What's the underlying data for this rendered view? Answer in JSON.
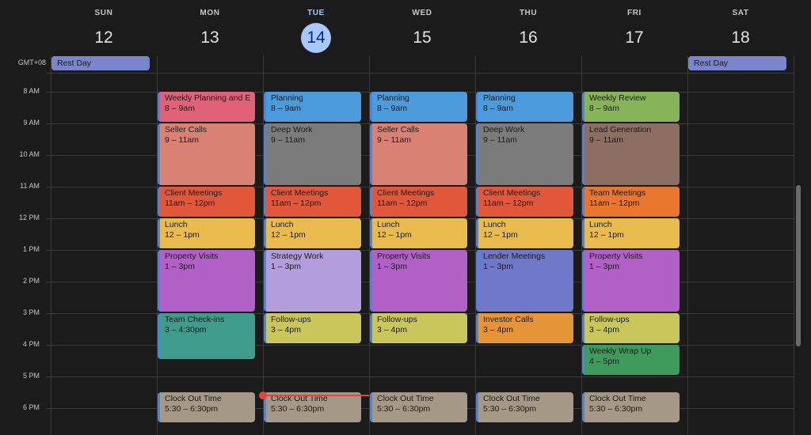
{
  "timezone": "GMT+08",
  "days": [
    {
      "dow": "SUN",
      "date": "12",
      "today": false
    },
    {
      "dow": "MON",
      "date": "13",
      "today": false
    },
    {
      "dow": "TUE",
      "date": "14",
      "today": true
    },
    {
      "dow": "WED",
      "date": "15",
      "today": false
    },
    {
      "dow": "THU",
      "date": "16",
      "today": false
    },
    {
      "dow": "FRI",
      "date": "17",
      "today": false
    },
    {
      "dow": "SAT",
      "date": "18",
      "today": false
    }
  ],
  "hours": [
    "8 AM",
    "9 AM",
    "10 AM",
    "11 AM",
    "12 PM",
    "1 PM",
    "2 PM",
    "3 PM",
    "4 PM",
    "5 PM",
    "6 PM"
  ],
  "all_day": [
    {
      "day": 0,
      "title": "Rest Day",
      "color": "#7986cb"
    },
    {
      "day": 6,
      "title": "Rest Day",
      "color": "#7986cb"
    }
  ],
  "colors": {
    "accent_today": "#a8c7fa",
    "now_indicator": "#ea4335"
  },
  "events": [
    {
      "day": 1,
      "start": 8,
      "end": 9,
      "title": "Weekly Planning and Email",
      "time": "8 – 9am",
      "color": "#e06178"
    },
    {
      "day": 1,
      "start": 9,
      "end": 11,
      "title": "Seller Calls",
      "time": "9 – 11am",
      "color": "#d98274"
    },
    {
      "day": 1,
      "start": 11,
      "end": 12,
      "title": "Client Meetings",
      "time": "11am – 12pm",
      "color": "#e0573a"
    },
    {
      "day": 1,
      "start": 12,
      "end": 13,
      "title": "Lunch",
      "time": "12 – 1pm",
      "color": "#e9bb4c"
    },
    {
      "day": 1,
      "start": 13,
      "end": 15,
      "title": "Property Visits",
      "time": "1 – 3pm",
      "color": "#b160c6"
    },
    {
      "day": 1,
      "start": 15,
      "end": 16.5,
      "title": "Team Check-ins",
      "time": "3 – 4:30pm",
      "color": "#3f9b8c"
    },
    {
      "day": 1,
      "start": 17.5,
      "end": 18.5,
      "title": "Clock Out Time",
      "time": "5:30 – 6:30pm",
      "color": "#a69887"
    },
    {
      "day": 2,
      "start": 8,
      "end": 9,
      "title": "Planning",
      "time": "8 – 9am",
      "color": "#4c9bdc"
    },
    {
      "day": 2,
      "start": 9,
      "end": 11,
      "title": "Deep Work",
      "time": "9 – 11am",
      "color": "#7b7b7b"
    },
    {
      "day": 2,
      "start": 11,
      "end": 12,
      "title": "Client Meetings",
      "time": "11am – 12pm",
      "color": "#e0573a"
    },
    {
      "day": 2,
      "start": 12,
      "end": 13,
      "title": "Lunch",
      "time": "12 – 1pm",
      "color": "#e9bb4c"
    },
    {
      "day": 2,
      "start": 13,
      "end": 15,
      "title": "Strategy Work",
      "time": "1 – 3pm",
      "color": "#b39ddb"
    },
    {
      "day": 2,
      "start": 15,
      "end": 16,
      "title": "Follow-ups",
      "time": "3 – 4pm",
      "color": "#c9c65b"
    },
    {
      "day": 2,
      "start": 17.5,
      "end": 18.5,
      "title": "Clock Out Time",
      "time": "5:30 – 6:30pm",
      "color": "#a69887"
    },
    {
      "day": 3,
      "start": 8,
      "end": 9,
      "title": "Planning",
      "time": "8 – 9am",
      "color": "#4c9bdc"
    },
    {
      "day": 3,
      "start": 9,
      "end": 11,
      "title": "Seller Calls",
      "time": "9 – 11am",
      "color": "#d98274"
    },
    {
      "day": 3,
      "start": 11,
      "end": 12,
      "title": "Client Meetings",
      "time": "11am – 12pm",
      "color": "#e0573a"
    },
    {
      "day": 3,
      "start": 12,
      "end": 13,
      "title": "Lunch",
      "time": "12 – 1pm",
      "color": "#e9bb4c"
    },
    {
      "day": 3,
      "start": 13,
      "end": 15,
      "title": "Property Visits",
      "time": "1 – 3pm",
      "color": "#b160c6"
    },
    {
      "day": 3,
      "start": 15,
      "end": 16,
      "title": "Follow-ups",
      "time": "3 – 4pm",
      "color": "#c9c65b"
    },
    {
      "day": 3,
      "start": 17.5,
      "end": 18.5,
      "title": "Clock Out Time",
      "time": "5:30 – 6:30pm",
      "color": "#a69887"
    },
    {
      "day": 4,
      "start": 8,
      "end": 9,
      "title": "Planning",
      "time": "8 – 9am",
      "color": "#4c9bdc"
    },
    {
      "day": 4,
      "start": 9,
      "end": 11,
      "title": "Deep Work",
      "time": "9 – 11am",
      "color": "#7b7b7b"
    },
    {
      "day": 4,
      "start": 11,
      "end": 12,
      "title": "Client Meetings",
      "time": "11am – 12pm",
      "color": "#e0573a"
    },
    {
      "day": 4,
      "start": 12,
      "end": 13,
      "title": "Lunch",
      "time": "12 – 1pm",
      "color": "#e9bb4c"
    },
    {
      "day": 4,
      "start": 13,
      "end": 15,
      "title": "Lender Meetings",
      "time": "1 – 3pm",
      "color": "#6f78c9"
    },
    {
      "day": 4,
      "start": 15,
      "end": 16,
      "title": "Investor Calls",
      "time": "3 – 4pm",
      "color": "#e59536"
    },
    {
      "day": 4,
      "start": 17.5,
      "end": 18.5,
      "title": "Clock Out Time",
      "time": "5:30 – 6:30pm",
      "color": "#a69887"
    },
    {
      "day": 5,
      "start": 8,
      "end": 9,
      "title": "Weekly Review",
      "time": "8 – 9am",
      "color": "#86b456"
    },
    {
      "day": 5,
      "start": 9,
      "end": 11,
      "title": "Lead Generation",
      "time": "9 – 11am",
      "color": "#8d6e63"
    },
    {
      "day": 5,
      "start": 11,
      "end": 12,
      "title": "Team Meetings",
      "time": "11am – 12pm",
      "color": "#e8762d"
    },
    {
      "day": 5,
      "start": 12,
      "end": 13,
      "title": "Lunch",
      "time": "12 – 1pm",
      "color": "#e9bb4c"
    },
    {
      "day": 5,
      "start": 13,
      "end": 15,
      "title": "Property Visits",
      "time": "1 – 3pm",
      "color": "#b160c6"
    },
    {
      "day": 5,
      "start": 15,
      "end": 16,
      "title": "Follow-ups",
      "time": "3 – 4pm",
      "color": "#c9c65b"
    },
    {
      "day": 5,
      "start": 16,
      "end": 17,
      "title": "Weekly Wrap Up",
      "time": "4 – 5pm",
      "color": "#3e9b5c"
    },
    {
      "day": 5,
      "start": 17.5,
      "end": 18.5,
      "title": "Clock Out Time",
      "time": "5:30 – 6:30pm",
      "color": "#a69887"
    }
  ],
  "current_time": {
    "day": 2,
    "hour": 17.6
  }
}
